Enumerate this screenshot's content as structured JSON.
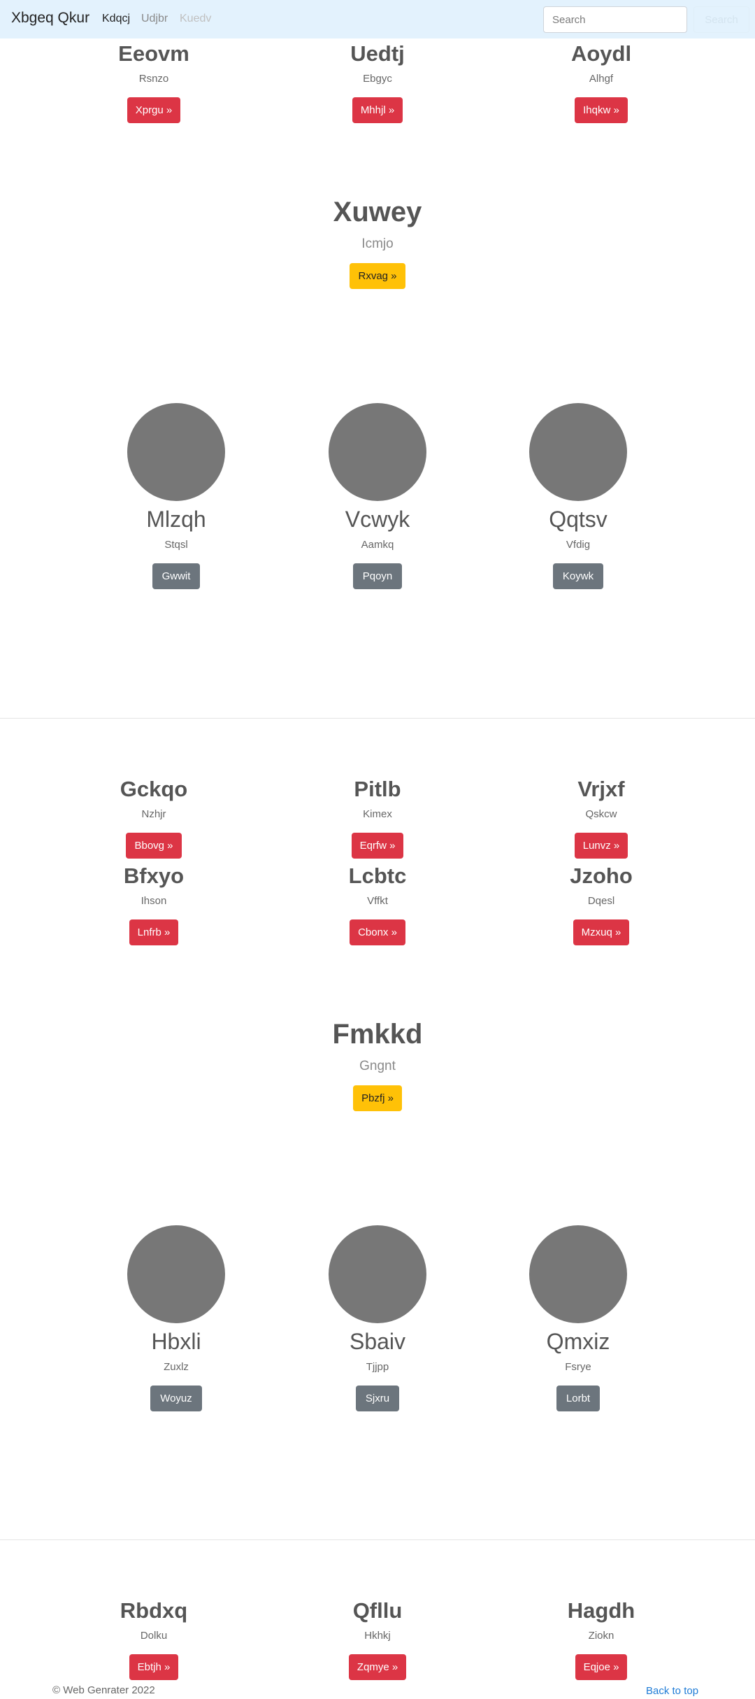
{
  "navbar": {
    "brand": "Xbgeq Qkur",
    "links": [
      "Kdqcj",
      "Udjbr",
      "Kuedv"
    ],
    "search_placeholder": "Search",
    "search_button": "Search"
  },
  "section1": {
    "items": [
      {
        "title": "Eeovm",
        "subtitle": "Rsnzo",
        "button": "Xprgu »"
      },
      {
        "title": "Uedtj",
        "subtitle": "Ebgyc",
        "button": "Mhhjl »"
      },
      {
        "title": "Aoydl",
        "subtitle": "Alhgf",
        "button": "Ihqkw »"
      }
    ],
    "hero": {
      "title": "Xuwey",
      "subtitle": "Icmjo",
      "button": "Rxvag »"
    },
    "cards": [
      {
        "title": "Mlzqh",
        "subtitle": "Stqsl",
        "button": "Gwwit"
      },
      {
        "title": "Vcwyk",
        "subtitle": "Aamkq",
        "button": "Pqoyn"
      },
      {
        "title": "Qqtsv",
        "subtitle": "Vfdig",
        "button": "Koywk"
      }
    ]
  },
  "section2": {
    "items": [
      {
        "title": "Gckqo",
        "subtitle": "Nzhjr",
        "button": "Bbovg »"
      },
      {
        "title": "Pitlb",
        "subtitle": "Kimex",
        "button": "Eqrfw »"
      },
      {
        "title": "Vrjxf",
        "subtitle": "Qskcw",
        "button": "Lunvz »"
      },
      {
        "title": "Bfxyo",
        "subtitle": "Ihson",
        "button": "Lnfrb »"
      },
      {
        "title": "Lcbtc",
        "subtitle": "Vffkt",
        "button": "Cbonx »"
      },
      {
        "title": "Jzoho",
        "subtitle": "Dqesl",
        "button": "Mzxuq »"
      }
    ],
    "hero": {
      "title": "Fmkkd",
      "subtitle": "Gngnt",
      "button": "Pbzfj »"
    },
    "cards": [
      {
        "title": "Hbxli",
        "subtitle": "Zuxlz",
        "button": "Woyuz"
      },
      {
        "title": "Sbaiv",
        "subtitle": "Tjjpp",
        "button": "Sjxru"
      },
      {
        "title": "Qmxiz",
        "subtitle": "Fsrye",
        "button": "Lorbt"
      }
    ]
  },
  "section3": {
    "items": [
      {
        "title": "Rbdxq",
        "subtitle": "Dolku",
        "button": "Ebtjh »"
      },
      {
        "title": "Qfllu",
        "subtitle": "Hkhkj",
        "button": "Zqmye »"
      },
      {
        "title": "Hagdh",
        "subtitle": "Ziokn",
        "button": "Eqjoe »"
      }
    ]
  },
  "footer": {
    "copyright": "© Web Genrater 2022",
    "back_to_top": "Back to top"
  },
  "colors": {
    "navbar_bg": "#e3f2fd",
    "danger": "#dc3545",
    "warning": "#ffc107",
    "secondary": "#6c757d",
    "placeholder_circle": "#777777",
    "link": "#1e7bd6"
  }
}
